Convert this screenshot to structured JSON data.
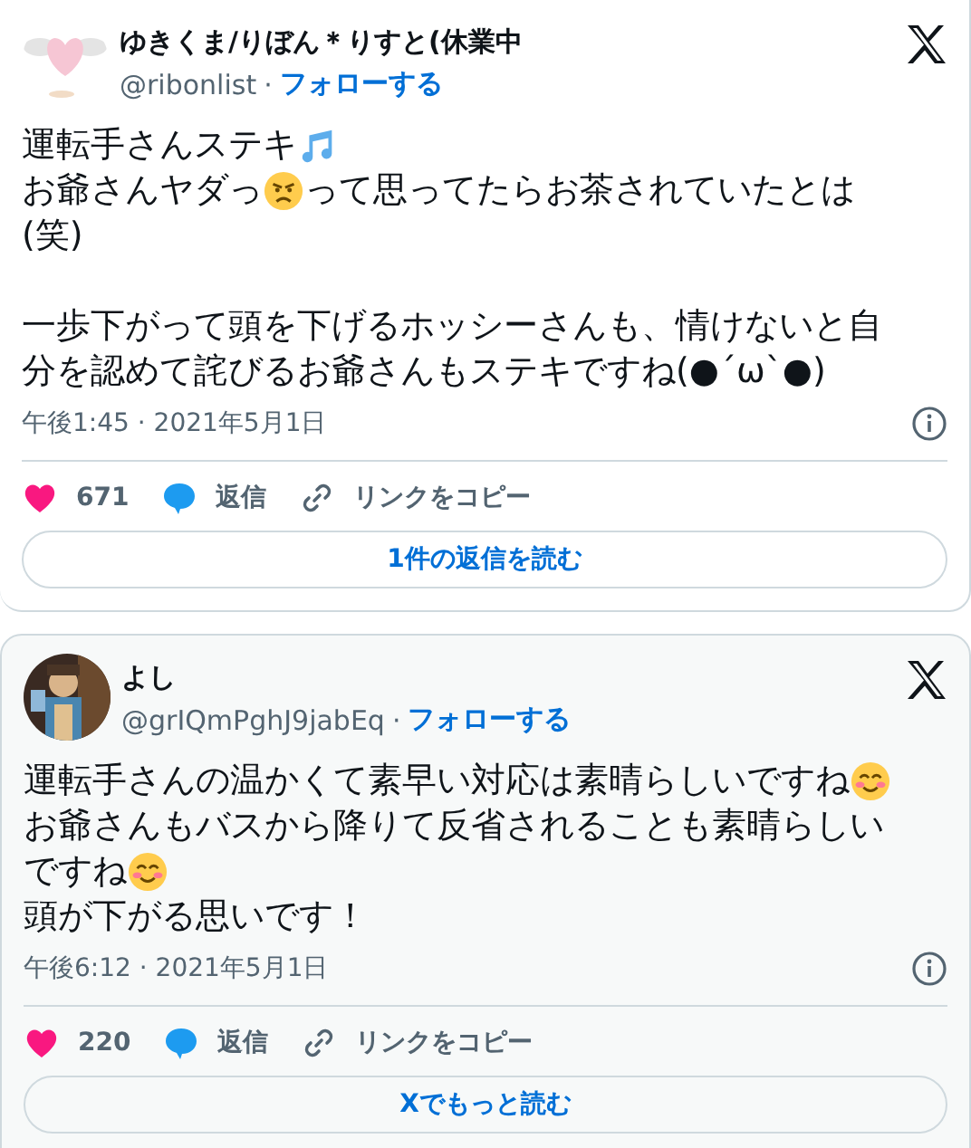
{
  "tweets": [
    {
      "avatar": {
        "kind": "heart"
      },
      "name": "ゆきくま/りぼん＊りすと(休業中",
      "handle": "@ribonlist",
      "separator": "·",
      "follow": "フォローする",
      "paragraphs": [
        {
          "lines": [
            [
              {
                "kind": "text",
                "text": "運転手さんステキ"
              },
              {
                "kind": "music"
              }
            ],
            [
              {
                "kind": "text",
                "text": "お爺さんヤダっ"
              },
              {
                "kind": "angry"
              },
              {
                "kind": "text",
                "text": "って思ってたらお茶されていたとは"
              }
            ],
            [
              {
                "kind": "text",
                "text": "(笑)"
              }
            ]
          ]
        },
        {
          "lines": [
            [
              {
                "kind": "text",
                "text": "一歩下がって頭を下げるホッシーさんも、情けないと自"
              }
            ],
            [
              {
                "kind": "text",
                "text": "分を認めて詫びるお爺さんもステキですね(●´ω`●)"
              }
            ]
          ]
        }
      ],
      "timestamp": "午後1:45 · 2021年5月1日",
      "likes": "671",
      "reply": "返信",
      "copy_link": "リンクをコピー",
      "button": "1件の返信を読む"
    },
    {
      "avatar": {
        "kind": "picture"
      },
      "name": "よし",
      "handle": "@grIQmPghJ9jabEq",
      "separator": "·",
      "follow": "フォローする",
      "paragraphs": [
        {
          "lines": [
            [
              {
                "kind": "text",
                "text": "運転手さんの温かくて素早い対応は素晴らしいですね"
              },
              {
                "kind": "smiling"
              }
            ],
            [
              {
                "kind": "text",
                "text": "お爺さんもバスから降りて反省されることも素晴らしい"
              }
            ],
            [
              {
                "kind": "text",
                "text": "ですね"
              },
              {
                "kind": "smiling"
              }
            ],
            [
              {
                "kind": "text",
                "text": "頭が下がる思いです！"
              }
            ]
          ]
        }
      ],
      "timestamp": "午後6:12 · 2021年5月1日",
      "likes": "220",
      "reply": "返信",
      "copy_link": "リンクをコピー",
      "button": "Xでもっと読む"
    }
  ]
}
